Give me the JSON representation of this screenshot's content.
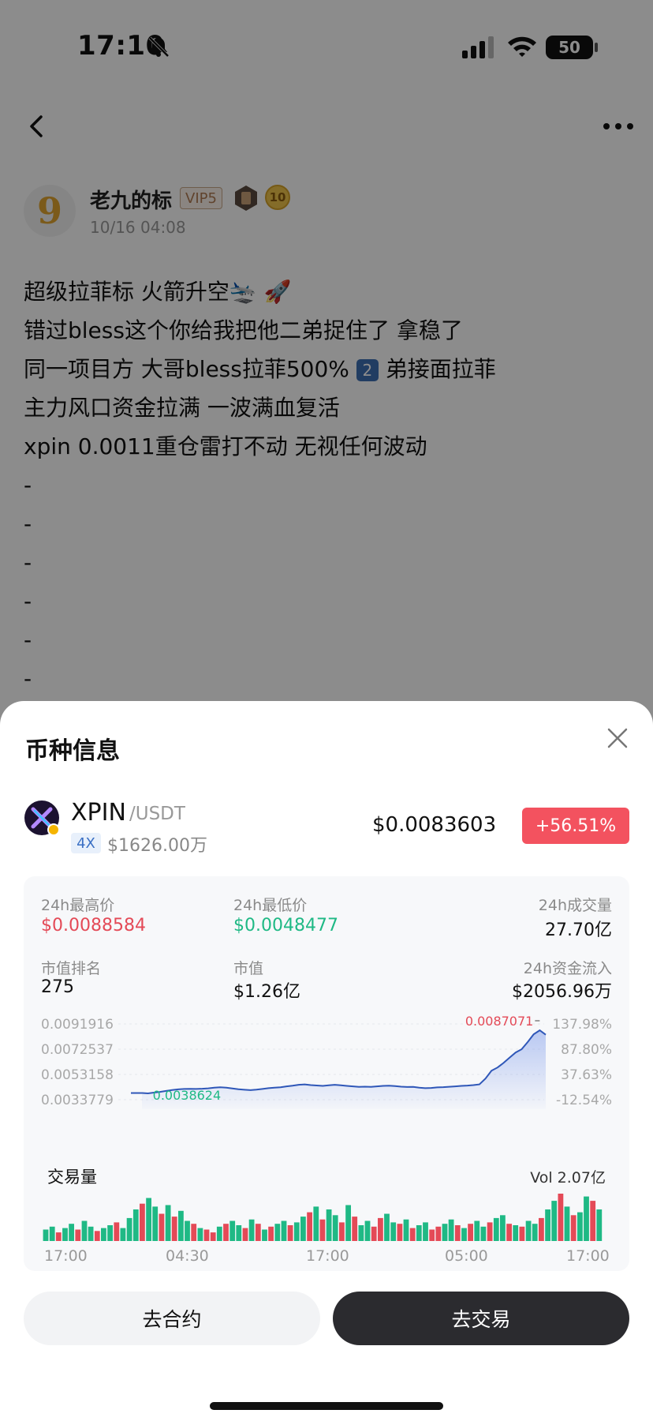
{
  "status_bar": {
    "time": "17:10",
    "battery": "50"
  },
  "post": {
    "author": "老九的标",
    "avatar_text": "9",
    "vip": "VIP5",
    "level": "10",
    "time": "10/16 04:08",
    "lines": [
      "超级拉菲标 火箭升空🛬 🚀",
      "错过bless这个你给我把他二弟捉住了 拿稳了",
      "同一项目方 大哥bless拉菲500%",
      "主力风口资金拉满 一波满血复活",
      "xpin 0.0011重仓雷打不动 无视任何波动",
      "-",
      "-",
      "-",
      "-",
      "-",
      "-"
    ],
    "line3_num": "2",
    "line3_tail": " 弟接面拉菲"
  },
  "sheet": {
    "title": "币种信息",
    "coin": {
      "symbol": "XPIN",
      "pair": "/USDT",
      "leverage": "4X",
      "market_cap_short": "$1626.00万",
      "price": "$0.0083603",
      "change": "+56.51%"
    },
    "stats": {
      "high_label": "24h最高价",
      "high_value": "$0.0088584",
      "low_label": "24h最低价",
      "low_value": "$0.0048477",
      "volume_label": "24h成交量",
      "volume_value": "27.70亿",
      "rank_label": "市值排名",
      "rank_value": "275",
      "mcap_label": "市值",
      "mcap_value": "$1.26亿",
      "inflow_label": "24h资金流入",
      "inflow_value": "$2056.96万"
    },
    "volume": {
      "title": "交易量",
      "total": "Vol 2.07亿"
    },
    "buttons": {
      "futures": "去合约",
      "trade": "去交易"
    },
    "colors": {
      "up": "#e44a57",
      "down": "#1fb985",
      "line": "#2f57b8"
    }
  },
  "chart_data": {
    "type": "line",
    "y_ticks": [
      "0.0091916",
      "0.0072537",
      "0.0053158",
      "0.0033779"
    ],
    "y_ticks_right": [
      "137.98%",
      "87.80%",
      "37.63%",
      "-12.54%"
    ],
    "x_labels": [
      "17:00",
      "04:30",
      "17:00",
      "05:00",
      "17:00"
    ],
    "ylim": [
      0.0033779,
      0.0091916
    ],
    "min_label": "0.0038624",
    "max_label": "0.0087071",
    "series": [
      {
        "values": [
          0.00389,
          0.00386,
          0.00392,
          0.00398,
          0.00405,
          0.00412,
          0.00417,
          0.0042,
          0.00421,
          0.0042,
          0.00422,
          0.00425,
          0.0043,
          0.00433,
          0.0043,
          0.00424,
          0.00418,
          0.00414,
          0.00411,
          0.00415,
          0.0042,
          0.00426,
          0.0043,
          0.00433,
          0.0044,
          0.00445,
          0.00452,
          0.00455,
          0.0045,
          0.00447,
          0.00444,
          0.00448,
          0.00452,
          0.00448,
          0.00444,
          0.0044,
          0.00436,
          0.00438,
          0.00436,
          0.0044,
          0.00444,
          0.00445,
          0.00442,
          0.00438,
          0.00435,
          0.00436,
          0.0043,
          0.00426,
          0.00428,
          0.00432,
          0.00434,
          0.00437,
          0.0044,
          0.00444,
          0.00446,
          0.0045,
          0.00455,
          0.005,
          0.0056,
          0.00585,
          0.0062,
          0.0066,
          0.007,
          0.00725,
          0.0078,
          0.0084,
          0.0087,
          0.00836
        ]
      }
    ]
  },
  "volume_data": {
    "type": "bar",
    "values": [
      8,
      10,
      6,
      9,
      12,
      8,
      14,
      10,
      7,
      9,
      11,
      13,
      9,
      16,
      22,
      26,
      30,
      24,
      19,
      25,
      17,
      21,
      14,
      12,
      9,
      8,
      6,
      10,
      12,
      14,
      11,
      9,
      15,
      12,
      8,
      10,
      12,
      14,
      11,
      13,
      17,
      20,
      24,
      15,
      22,
      18,
      13,
      25,
      17,
      11,
      14,
      10,
      16,
      19,
      13,
      12,
      15,
      9,
      11,
      13,
      8,
      10,
      12,
      15,
      11,
      9,
      12,
      14,
      10,
      13,
      16,
      18,
      12,
      11,
      10,
      14,
      12,
      16,
      22,
      28,
      33,
      24,
      18,
      20,
      31,
      28,
      22
    ],
    "up": [
      1,
      1,
      0,
      1,
      1,
      0,
      1,
      1,
      0,
      1,
      1,
      0,
      1,
      1,
      1,
      0,
      1,
      1,
      0,
      1,
      0,
      1,
      1,
      0,
      1,
      0,
      0,
      1,
      0,
      1,
      1,
      0,
      1,
      0,
      1,
      0,
      1,
      1,
      0,
      1,
      1,
      0,
      1,
      0,
      1,
      1,
      0,
      1,
      0,
      1,
      1,
      0,
      0,
      1,
      1,
      0,
      1,
      0,
      1,
      1,
      0,
      0,
      1,
      1,
      0,
      1,
      0,
      1,
      1,
      0,
      1,
      1,
      0,
      1,
      0,
      1,
      1,
      0,
      1,
      1,
      0,
      1,
      0,
      1,
      1,
      0,
      1
    ]
  }
}
